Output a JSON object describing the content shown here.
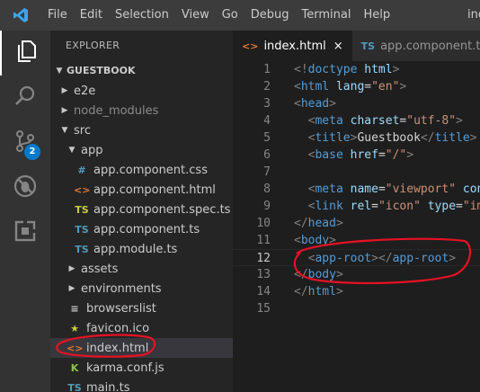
{
  "menu": [
    "File",
    "Edit",
    "Selection",
    "View",
    "Go",
    "Debug",
    "Terminal",
    "Help"
  ],
  "window_title_fragment": "ind",
  "activity": {
    "scm_badge": "2"
  },
  "sidebar": {
    "title": "EXPLORER",
    "section": "GUESTBOOK",
    "items": [
      {
        "label": "e2e",
        "indent": 1,
        "twisty": "▶",
        "icon": "",
        "icon_color": "",
        "dim": false
      },
      {
        "label": "node_modules",
        "indent": 1,
        "twisty": "▶",
        "icon": "",
        "icon_color": "",
        "dim": true
      },
      {
        "label": "src",
        "indent": 1,
        "twisty": "▼",
        "icon": "",
        "icon_color": "",
        "dim": false
      },
      {
        "label": "app",
        "indent": 2,
        "twisty": "▼",
        "icon": "",
        "icon_color": "",
        "dim": false
      },
      {
        "label": "app.component.css",
        "indent": 3,
        "twisty": "",
        "icon": "#",
        "icon_color": "#519aba",
        "dim": false
      },
      {
        "label": "app.component.html",
        "indent": 3,
        "twisty": "",
        "icon": "<>",
        "icon_color": "#e37933",
        "dim": false
      },
      {
        "label": "app.component.spec.ts",
        "indent": 3,
        "twisty": "",
        "icon": "TS",
        "icon_color": "#cbcb41",
        "dim": false
      },
      {
        "label": "app.component.ts",
        "indent": 3,
        "twisty": "",
        "icon": "TS",
        "icon_color": "#519aba",
        "dim": false
      },
      {
        "label": "app.module.ts",
        "indent": 3,
        "twisty": "",
        "icon": "TS",
        "icon_color": "#519aba",
        "dim": false
      },
      {
        "label": "assets",
        "indent": 2,
        "twisty": "▶",
        "icon": "",
        "icon_color": "",
        "dim": false
      },
      {
        "label": "environments",
        "indent": 2,
        "twisty": "▶",
        "icon": "",
        "icon_color": "",
        "dim": false
      },
      {
        "label": "browserslist",
        "indent": 2,
        "twisty": "",
        "icon": "≡",
        "icon_color": "#cccccc",
        "dim": false
      },
      {
        "label": "favicon.ico",
        "indent": 2,
        "twisty": "",
        "icon": "★",
        "icon_color": "#cbcb41",
        "dim": false
      },
      {
        "label": "index.html",
        "indent": 2,
        "twisty": "",
        "icon": "<>",
        "icon_color": "#e37933",
        "dim": false,
        "selected": true
      },
      {
        "label": "karma.conf.js",
        "indent": 2,
        "twisty": "",
        "icon": "K",
        "icon_color": "#8dc149",
        "dim": false
      },
      {
        "label": "main.ts",
        "indent": 2,
        "twisty": "",
        "icon": "TS",
        "icon_color": "#519aba",
        "dim": false
      }
    ]
  },
  "tabs": [
    {
      "label": "index.html",
      "icon": "<>",
      "icon_color": "#e37933",
      "active": true,
      "close": "×"
    },
    {
      "label": "app.component.ts",
      "icon": "TS",
      "icon_color": "#519aba",
      "active": false,
      "close": ""
    }
  ],
  "editor": {
    "current_line": 12,
    "lines": [
      {
        "n": "1",
        "tokens": [
          [
            "br",
            "<!"
          ],
          [
            "tg",
            "doctype"
          ],
          [
            "tx",
            " "
          ],
          [
            "at",
            "html"
          ],
          [
            "br",
            ">"
          ]
        ]
      },
      {
        "n": "2",
        "tokens": [
          [
            "br",
            "<"
          ],
          [
            "tg",
            "html"
          ],
          [
            "tx",
            " "
          ],
          [
            "at",
            "lang"
          ],
          [
            "tx",
            "="
          ],
          [
            "st",
            "\"en\""
          ],
          [
            "br",
            ">"
          ]
        ]
      },
      {
        "n": "3",
        "tokens": [
          [
            "br",
            "<"
          ],
          [
            "tg",
            "head"
          ],
          [
            "br",
            ">"
          ]
        ]
      },
      {
        "n": "4",
        "tokens": [
          [
            "tx",
            "  "
          ],
          [
            "br",
            "<"
          ],
          [
            "tg",
            "meta"
          ],
          [
            "tx",
            " "
          ],
          [
            "at",
            "charset"
          ],
          [
            "tx",
            "="
          ],
          [
            "st",
            "\"utf-8\""
          ],
          [
            "br",
            ">"
          ]
        ]
      },
      {
        "n": "5",
        "tokens": [
          [
            "tx",
            "  "
          ],
          [
            "br",
            "<"
          ],
          [
            "tg",
            "title"
          ],
          [
            "br",
            ">"
          ],
          [
            "tx",
            "Guestbook"
          ],
          [
            "br",
            "</"
          ],
          [
            "tg",
            "title"
          ],
          [
            "br",
            ">"
          ]
        ]
      },
      {
        "n": "6",
        "tokens": [
          [
            "tx",
            "  "
          ],
          [
            "br",
            "<"
          ],
          [
            "tg",
            "base"
          ],
          [
            "tx",
            " "
          ],
          [
            "at",
            "href"
          ],
          [
            "tx",
            "="
          ],
          [
            "st",
            "\"/\""
          ],
          [
            "br",
            ">"
          ]
        ]
      },
      {
        "n": "7",
        "tokens": []
      },
      {
        "n": "8",
        "tokens": [
          [
            "tx",
            "  "
          ],
          [
            "br",
            "<"
          ],
          [
            "tg",
            "meta"
          ],
          [
            "tx",
            " "
          ],
          [
            "at",
            "name"
          ],
          [
            "tx",
            "="
          ],
          [
            "st",
            "\"viewport\""
          ],
          [
            "tx",
            " "
          ],
          [
            "at",
            "con"
          ]
        ]
      },
      {
        "n": "9",
        "tokens": [
          [
            "tx",
            "  "
          ],
          [
            "br",
            "<"
          ],
          [
            "tg",
            "link"
          ],
          [
            "tx",
            " "
          ],
          [
            "at",
            "rel"
          ],
          [
            "tx",
            "="
          ],
          [
            "st",
            "\"icon\""
          ],
          [
            "tx",
            " "
          ],
          [
            "at",
            "type"
          ],
          [
            "tx",
            "="
          ],
          [
            "st",
            "\"im"
          ]
        ]
      },
      {
        "n": "10",
        "tokens": [
          [
            "br",
            "</"
          ],
          [
            "tg",
            "head"
          ],
          [
            "br",
            ">"
          ]
        ]
      },
      {
        "n": "11",
        "tokens": [
          [
            "br",
            "<"
          ],
          [
            "tg",
            "body"
          ],
          [
            "br",
            ">"
          ]
        ]
      },
      {
        "n": "12",
        "tokens": [
          [
            "tx",
            "  "
          ],
          [
            "br",
            "<"
          ],
          [
            "tg",
            "app-root"
          ],
          [
            "br",
            ">"
          ],
          [
            "br",
            "</"
          ],
          [
            "tg",
            "app-root"
          ],
          [
            "br",
            ">"
          ]
        ]
      },
      {
        "n": "13",
        "tokens": [
          [
            "br",
            "</"
          ],
          [
            "tg",
            "body"
          ],
          [
            "br",
            ">"
          ]
        ]
      },
      {
        "n": "14",
        "tokens": [
          [
            "br",
            "</"
          ],
          [
            "tg",
            "html"
          ],
          [
            "br",
            ">"
          ]
        ]
      },
      {
        "n": "15",
        "tokens": []
      }
    ]
  }
}
